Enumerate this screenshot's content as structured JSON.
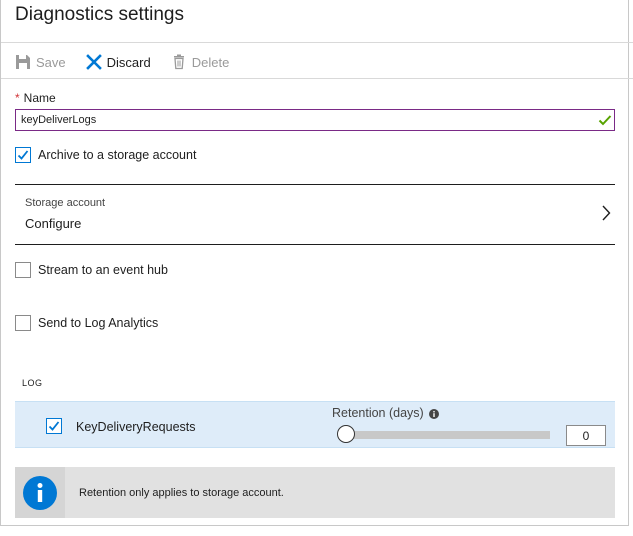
{
  "header": {
    "title": "Diagnostics settings"
  },
  "toolbar": {
    "save_label": "Save",
    "discard_label": "Discard",
    "delete_label": "Delete",
    "save_icon": "save-icon",
    "discard_icon": "close-x-icon",
    "delete_icon": "trash-icon"
  },
  "name_field": {
    "required_marker": "*",
    "label": "Name",
    "value": "keyDeliverLogs",
    "valid": true
  },
  "options": {
    "archive": {
      "label": "Archive to a storage account",
      "checked": true
    },
    "stream": {
      "label": "Stream to an event hub",
      "checked": false
    },
    "log_analytics": {
      "label": "Send to Log Analytics",
      "checked": false
    }
  },
  "storage_account": {
    "label": "Storage account",
    "value": "Configure"
  },
  "log": {
    "heading": "LOG",
    "rows": [
      {
        "name": "KeyDeliveryRequests",
        "checked": true,
        "retention_label": "Retention (days)",
        "retention_days": "0",
        "slider_fraction": 0
      }
    ]
  },
  "info": {
    "text": "Retention only applies to storage account."
  },
  "colors": {
    "accent": "#0078d4",
    "input_border": "#7a2a86",
    "valid_check": "#57a300",
    "log_row_bg": "#deecf9",
    "info_bar_bg": "#e1e1e1"
  }
}
